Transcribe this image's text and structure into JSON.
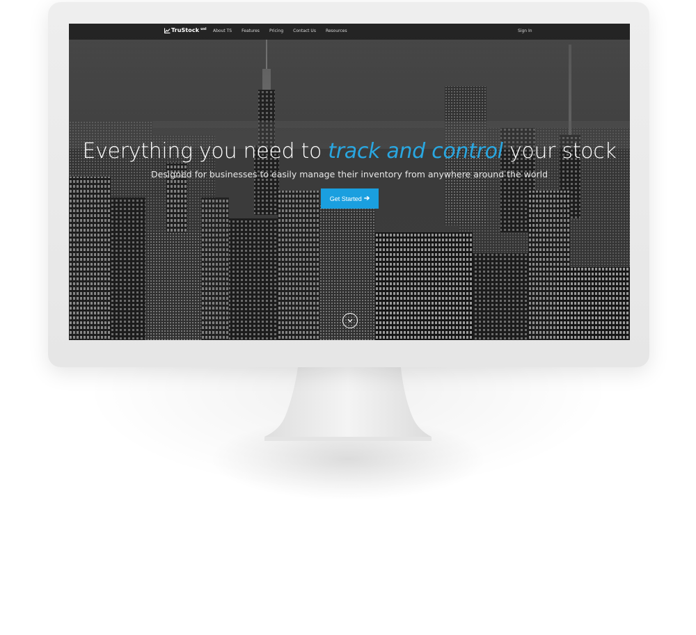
{
  "navbar": {
    "brand": "TruStock",
    "brand_sup": "usi",
    "links": [
      "About TS",
      "Features",
      "Pricing",
      "Contact Us",
      "Resources"
    ],
    "sign_in": "Sign In"
  },
  "hero": {
    "title_before": "Everything you need to ",
    "title_accent": "track and control",
    "title_after": " your stock",
    "subtitle": "Designed for businesses to easily manage their inventory from anywhere around the world",
    "cta_label": "Get Started",
    "cta_icon": "arrow-right-icon",
    "scroll_icon": "chevron-down-circle-icon"
  },
  "colors": {
    "accent": "#29a7e1",
    "button": "#1a9fdf",
    "navbar_bg": "#222222",
    "monitor_frame": "#eaeaea"
  }
}
